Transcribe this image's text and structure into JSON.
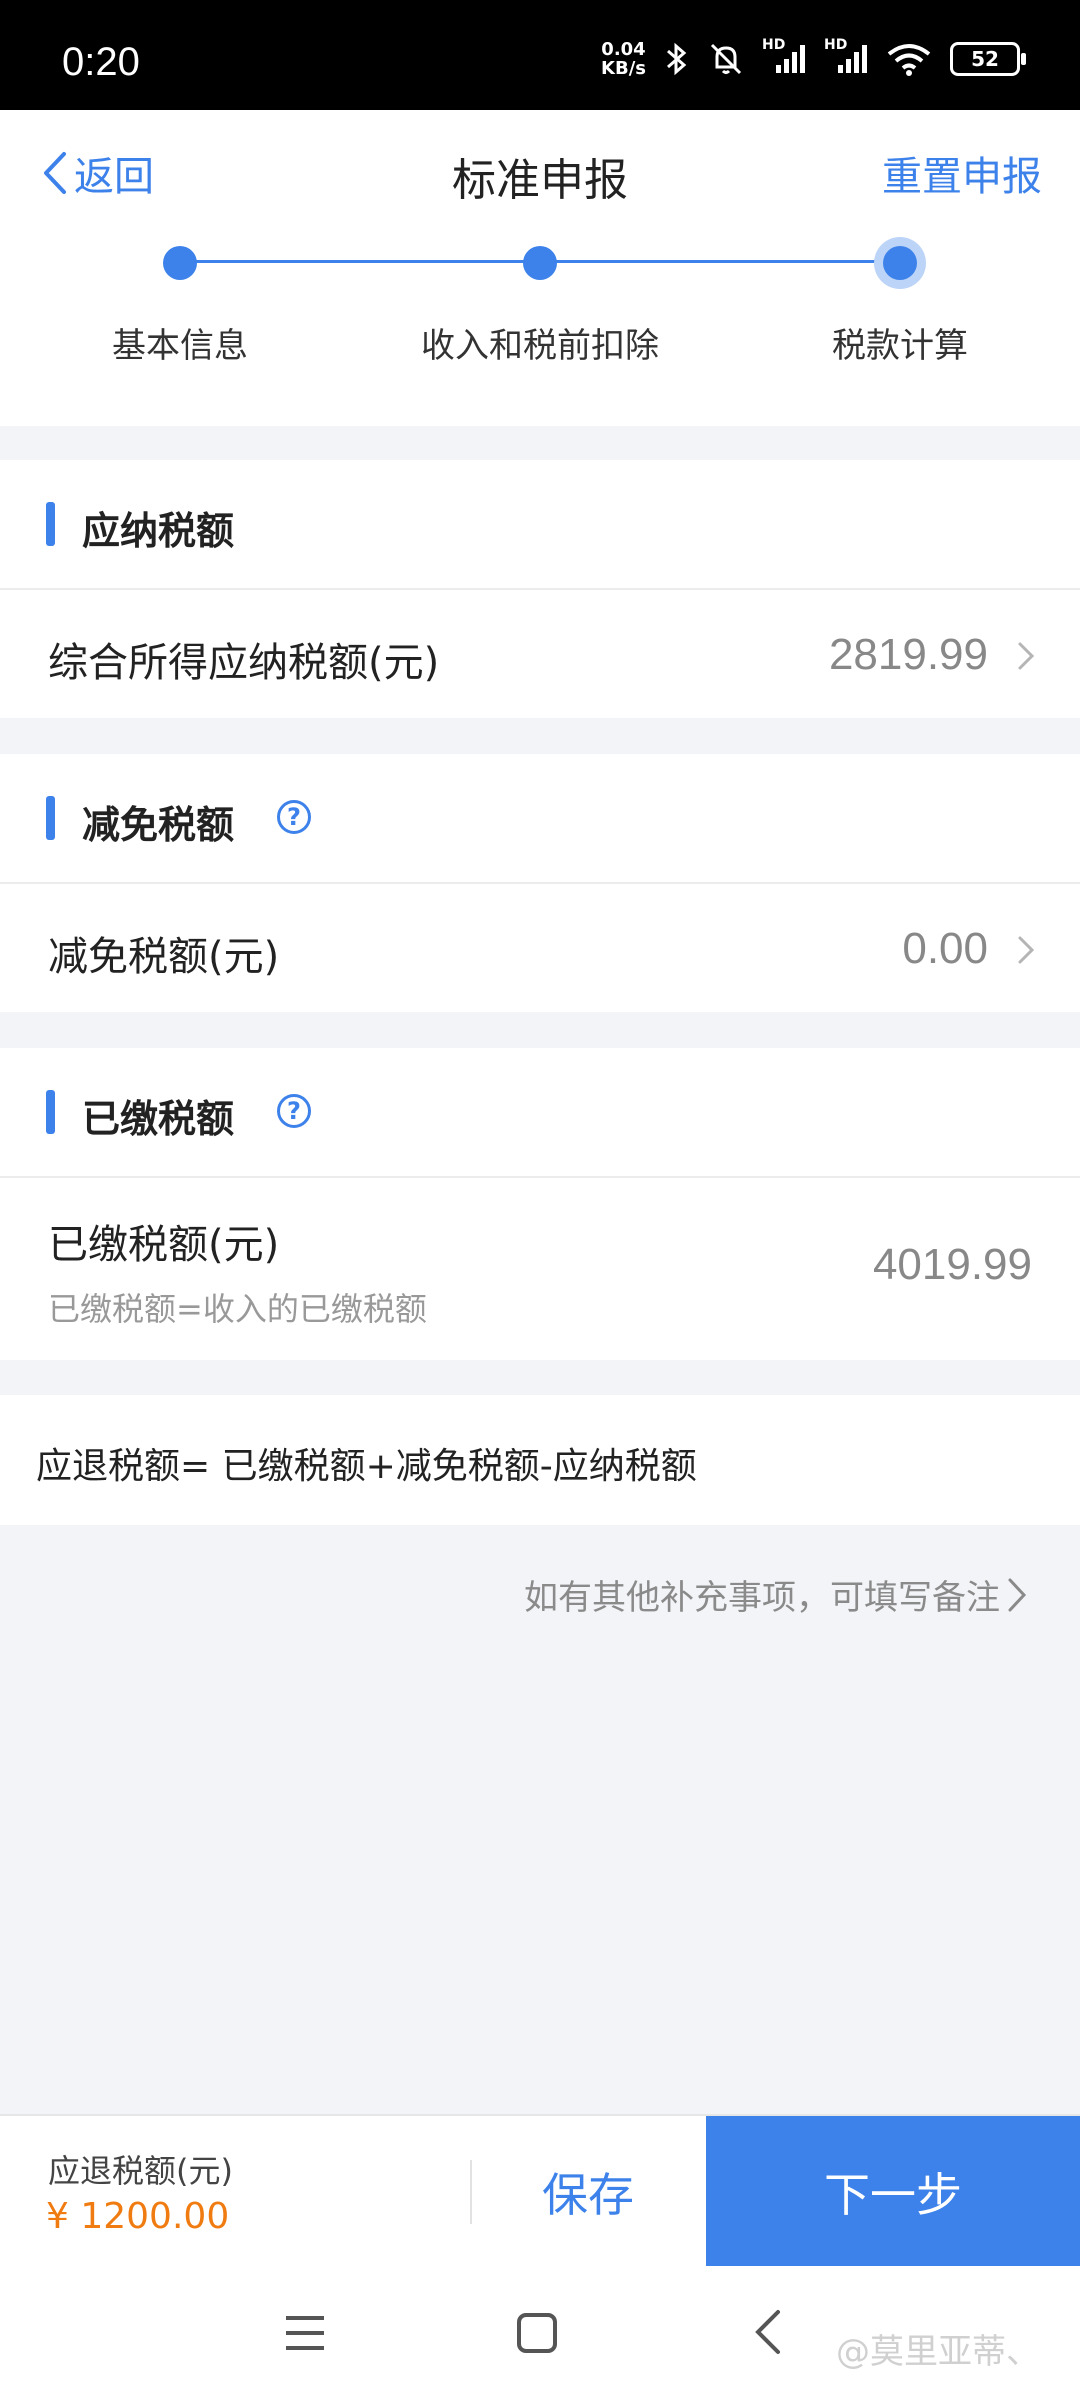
{
  "status": {
    "time": "0:20",
    "speed_value": "0.04",
    "speed_unit": "KB/s",
    "hd1": "HD",
    "hd2": "HD",
    "battery": "52"
  },
  "nav": {
    "back_label": "返回",
    "title": "标准申报",
    "reset_label": "重置申报"
  },
  "steps": [
    {
      "label": "基本信息"
    },
    {
      "label": "收入和税前扣除"
    },
    {
      "label": "税款计算"
    }
  ],
  "sections": {
    "payable": {
      "title": "应纳税额",
      "row_label": "综合所得应纳税额(元)",
      "row_value": "2819.99"
    },
    "reduction": {
      "title": "减免税额",
      "help": "?",
      "row_label": "减免税额(元)",
      "row_value": "0.00"
    },
    "paid": {
      "title": "已缴税额",
      "help": "?",
      "row_label": "已缴税额(元)",
      "row_sublabel": "已缴税额=收入的已缴税额",
      "row_value": "4019.99"
    }
  },
  "formula": "应退税额= 已缴税额+减免税额-应纳税额",
  "remark_link": "如有其他补充事项，可填写备注",
  "bottom": {
    "refund_label": "应退税额(元)",
    "refund_amount": "¥ 1200.00",
    "save_label": "保存",
    "next_label": "下一步"
  },
  "watermark": "@莫里亚蒂、",
  "colors": {
    "accent": "#3d82ea",
    "amount": "#f07c11"
  }
}
